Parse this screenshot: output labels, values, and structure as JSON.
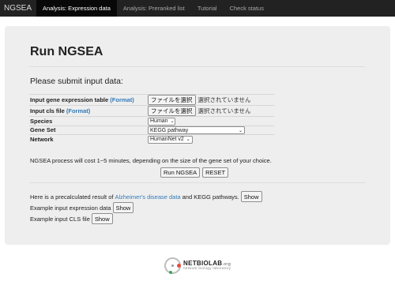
{
  "navbar": {
    "brand": "NGSEA",
    "tabs": [
      {
        "label": "Analysis: Expression data",
        "active": true
      },
      {
        "label": "Analysis: Preranked list",
        "active": false
      },
      {
        "label": "Tutorial",
        "active": false
      },
      {
        "label": "Check status",
        "active": false
      }
    ]
  },
  "main": {
    "title": "Run NGSEA",
    "subtitle": "Please submit input data:",
    "form": {
      "expression_label": "Input gene expression table",
      "expression_format": "(Format)",
      "cls_label": "Input cls file",
      "cls_format": "(Format)",
      "file_button": "ファイルを選択",
      "no_file_text": "選択されていません",
      "species_label": "Species",
      "species_value": "Human",
      "geneset_label": "Gene Set",
      "geneset_value": "KEGG pathway",
      "network_label": "Network",
      "network_value": "HumanNet v2"
    },
    "note": "NGSEA process will cost 1~5 minutes, depending on the size of the gene set of your choice.",
    "run_button": "Run NGSEA",
    "reset_button": "RESET",
    "precalc": {
      "prefix": "Here is a precalculated result of",
      "link": "Alzheimer's disease data",
      "suffix": "and KEGG pathways.",
      "button": "Show"
    },
    "example_expression": {
      "label": "Example input expression data",
      "button": "Show"
    },
    "example_cls": {
      "label": "Example input CLS file",
      "button": "Show"
    }
  },
  "footer": {
    "logo_main": "NETBIOLAB",
    "logo_org": ".org",
    "logo_sub": "network biology laboratory"
  },
  "colors": {
    "navbar": "#222222",
    "navbar_active": "#080808",
    "panel": "#eeeeee",
    "link": "#337ab7"
  }
}
